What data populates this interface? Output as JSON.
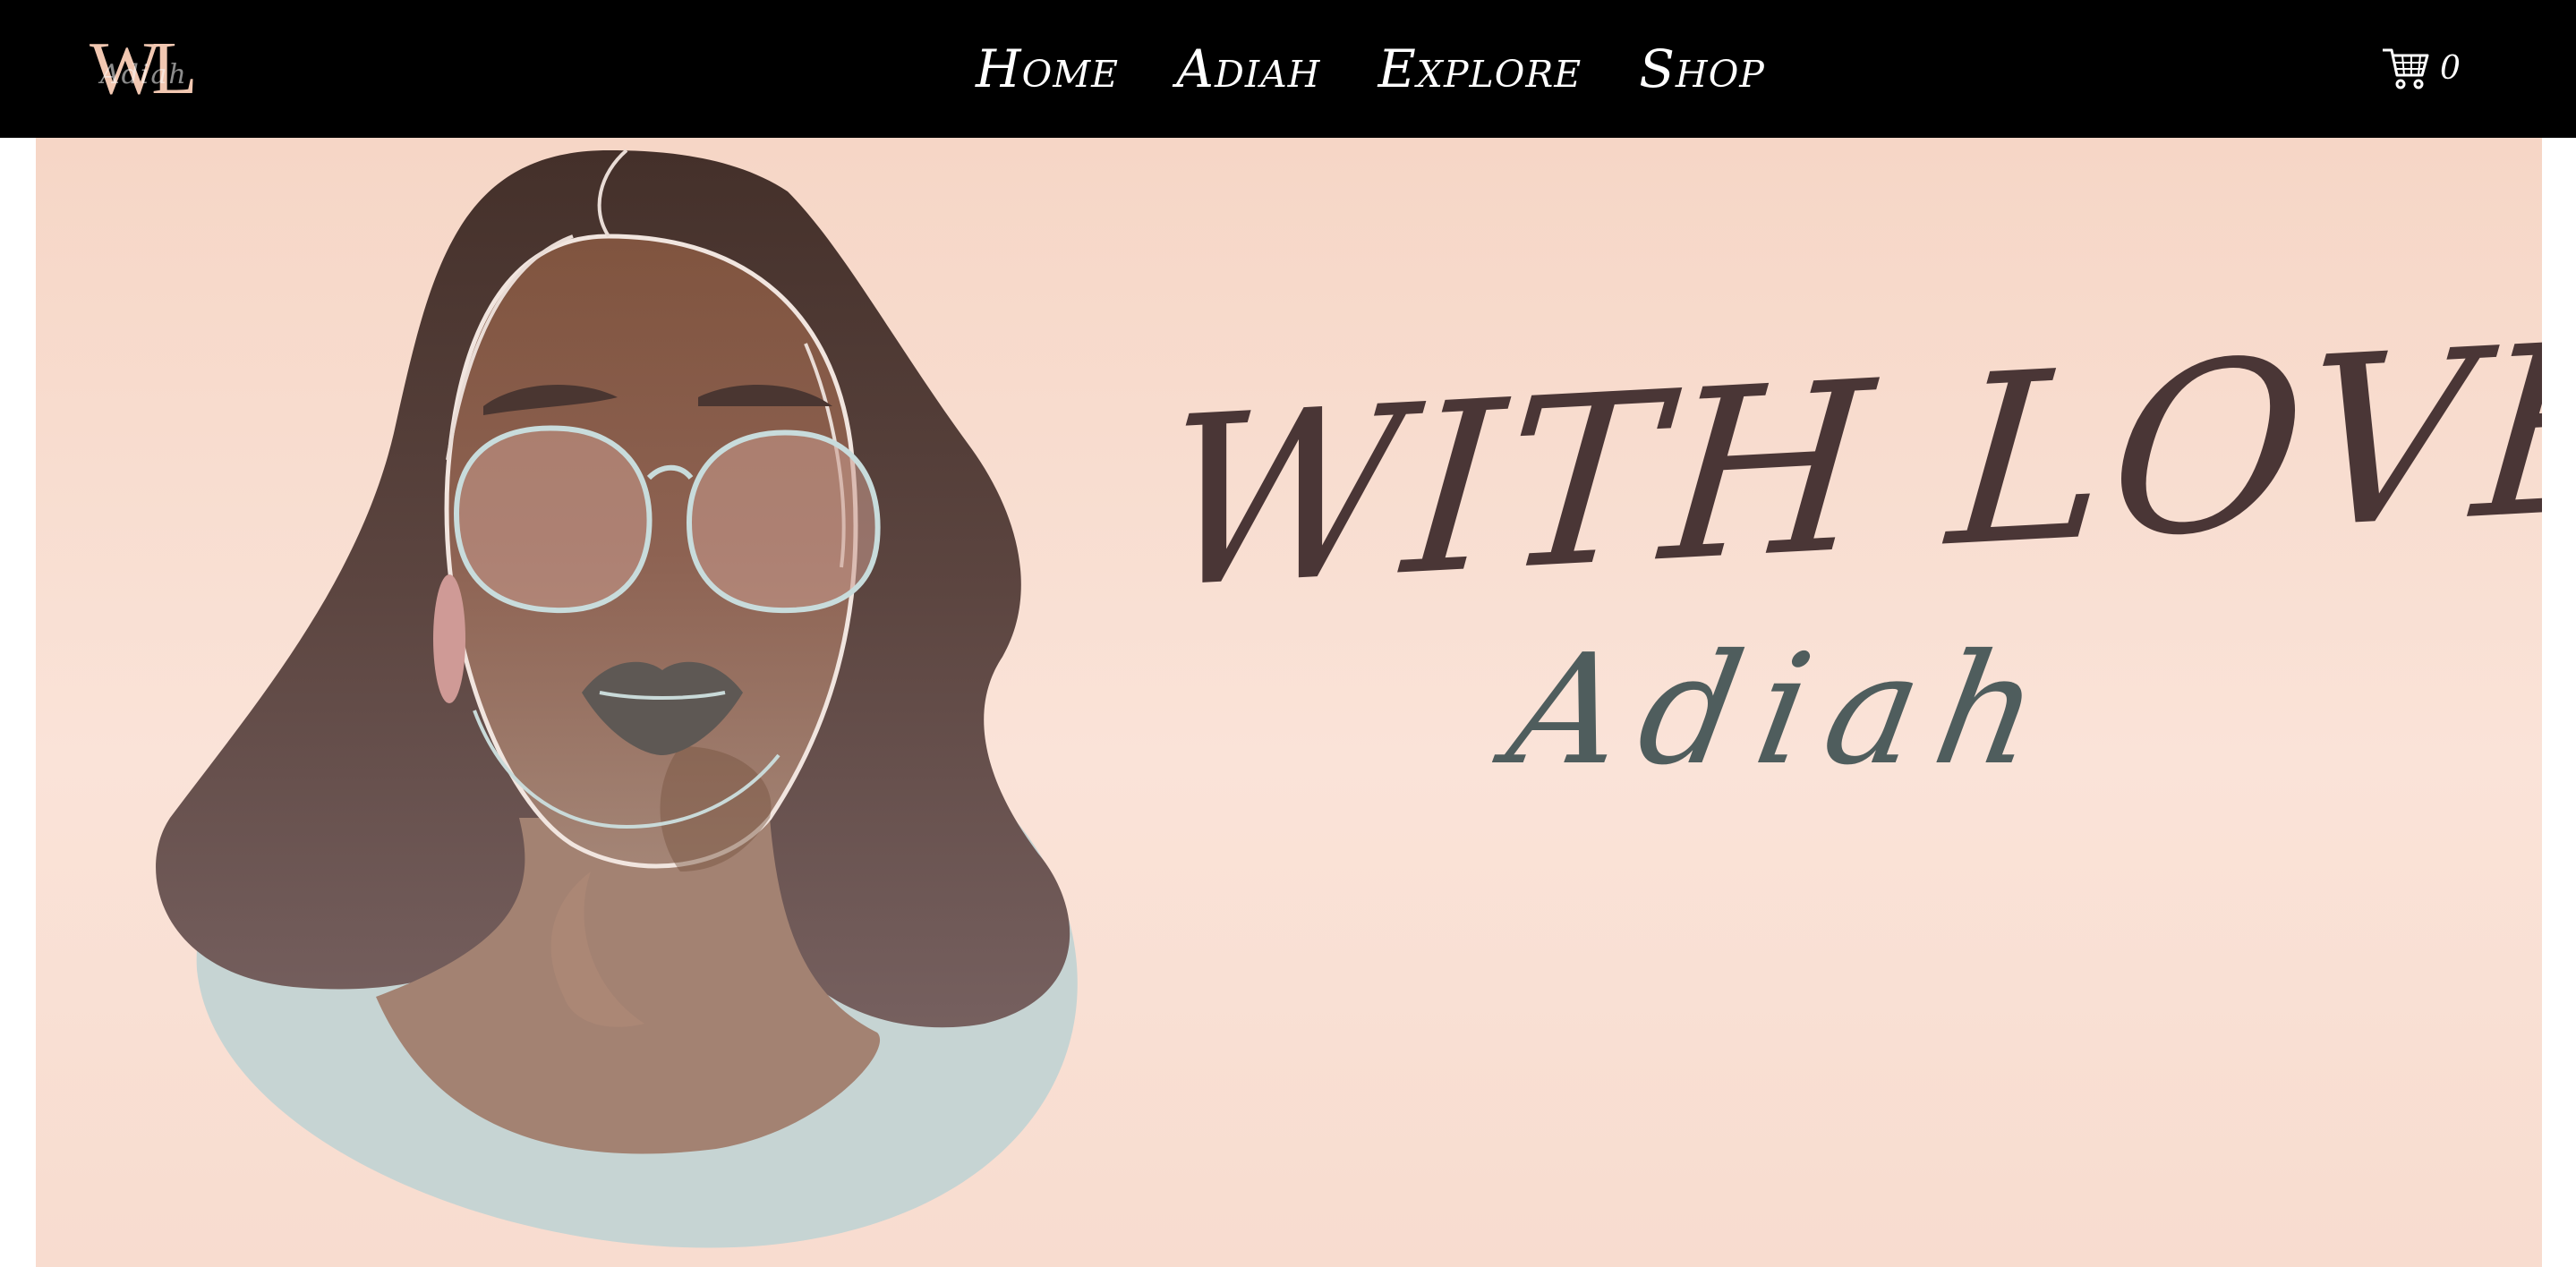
{
  "header": {
    "logo": {
      "letters": "WL",
      "script": "Adiah"
    },
    "nav": [
      {
        "label": "Home"
      },
      {
        "label": "Adiah"
      },
      {
        "label": "Explore"
      },
      {
        "label": "Shop"
      }
    ],
    "cart": {
      "icon": "cart-icon",
      "count": "0"
    }
  },
  "hero": {
    "title": "WITH LOVE,",
    "subtitle": "Adiah",
    "illustration": "portrait-illustration"
  },
  "colors": {
    "header_bg": "#000000",
    "hero_bg": "#f8dccf",
    "logo": "#f1c7b1",
    "hair": "#5e4540",
    "skin": "#9c7565",
    "accent_blue": "#c6d4d3",
    "script_text": "#4a3636"
  }
}
